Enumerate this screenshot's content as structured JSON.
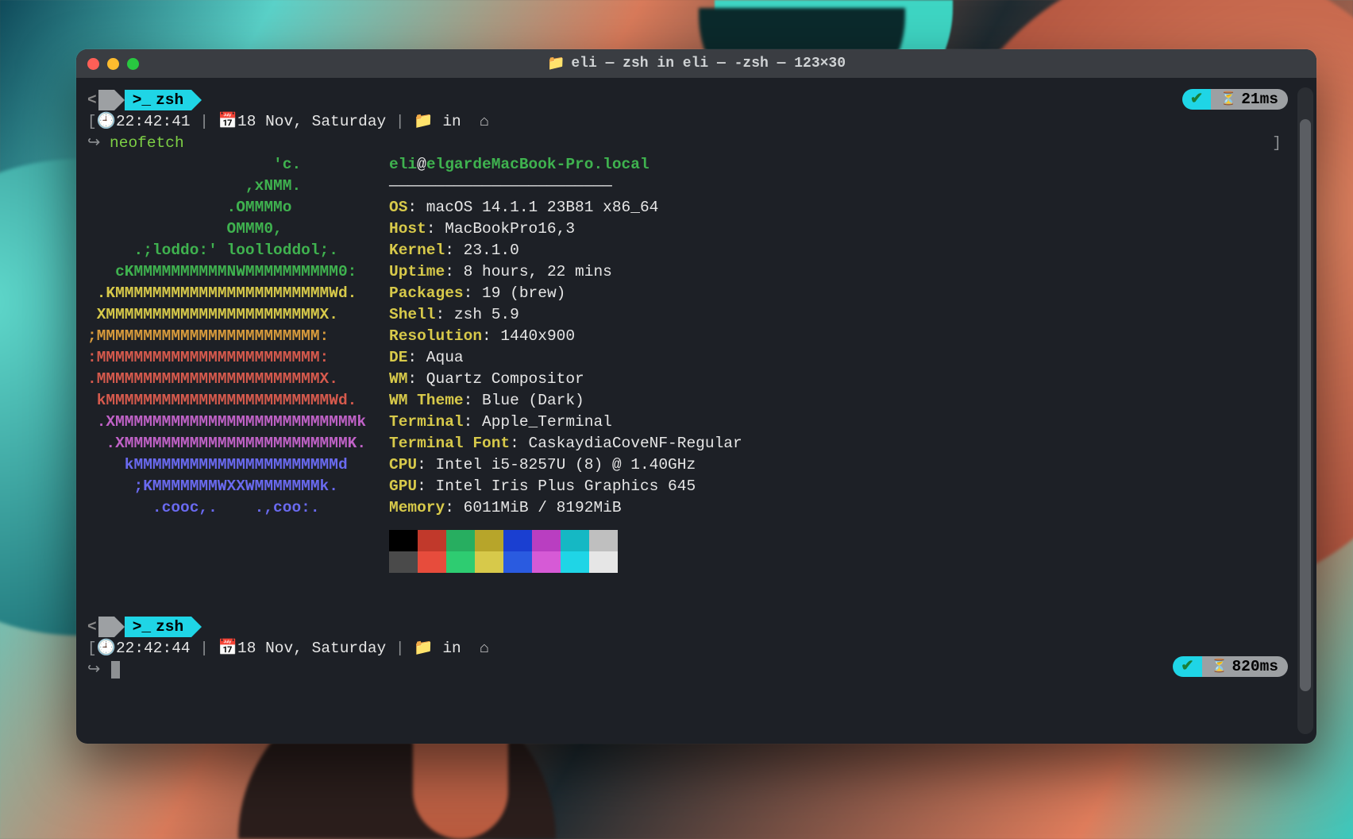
{
  "window": {
    "title": "eli — zsh in eli — -zsh — 123×30",
    "folder_icon": "📁"
  },
  "prompt1": {
    "apple": "",
    "shell_label": "zsh",
    "time": "22:42:41",
    "date": "18 Nov, Saturday",
    "in_word": "in",
    "badge_time": "21ms"
  },
  "command1": "neofetch",
  "logo": [
    "                    'c.          ",
    "                 ,xNMM.          ",
    "               .OMMMMo           ",
    "               OMMM0,            ",
    "     .;loddo:' loolloddol;.      ",
    "   cKMMMMMMMMMMNWMMMMMMMMMM0:    ",
    " .KMMMMMMMMMMMMMMMMMMMMMMMWd.    ",
    " XMMMMMMMMMMMMMMMMMMMMMMMX.      ",
    ";MMMMMMMMMMMMMMMMMMMMMMMM:       ",
    ":MMMMMMMMMMMMMMMMMMMMMMMM:       ",
    ".MMMMMMMMMMMMMMMMMMMMMMMMX.      ",
    " kMMMMMMMMMMMMMMMMMMMMMMMMWd.    ",
    " .XMMMMMMMMMMMMMMMMMMMMMMMMMMk   ",
    "  .XMMMMMMMMMMMMMMMMMMMMMMMMK.   ",
    "    kMMMMMMMMMMMMMMMMMMMMMMd     ",
    "     ;KMMMMMMMWXXWMMMMMMMk.      ",
    "       .cooc,.    .,coo:.        "
  ],
  "logo_colors": [
    "green",
    "green",
    "green",
    "green",
    "green",
    "green",
    "yellow",
    "yellow",
    "orange",
    "red",
    "red",
    "red",
    "violet",
    "violet",
    "blue",
    "blue",
    "blue"
  ],
  "header": {
    "user": "eli",
    "at": "@",
    "host": "elgardeMacBook-Pro.local",
    "rule": "————————————————————————"
  },
  "info": [
    {
      "k": "OS",
      "v": "macOS 14.1.1 23B81 x86_64"
    },
    {
      "k": "Host",
      "v": "MacBookPro16,3"
    },
    {
      "k": "Kernel",
      "v": "23.1.0"
    },
    {
      "k": "Uptime",
      "v": "8 hours, 22 mins"
    },
    {
      "k": "Packages",
      "v": "19 (brew)"
    },
    {
      "k": "Shell",
      "v": "zsh 5.9"
    },
    {
      "k": "Resolution",
      "v": "1440x900"
    },
    {
      "k": "DE",
      "v": "Aqua"
    },
    {
      "k": "WM",
      "v": "Quartz Compositor"
    },
    {
      "k": "WM Theme",
      "v": "Blue (Dark)"
    },
    {
      "k": "Terminal",
      "v": "Apple_Terminal"
    },
    {
      "k": "Terminal Font",
      "v": "CaskaydiaCoveNF-Regular"
    },
    {
      "k": "CPU",
      "v": "Intel i5-8257U (8) @ 1.40GHz"
    },
    {
      "k": "GPU",
      "v": "Intel Iris Plus Graphics 645"
    },
    {
      "k": "Memory",
      "v": "6011MiB / 8192MiB"
    }
  ],
  "prompt2": {
    "apple": "",
    "shell_label": "zsh",
    "time": "22:42:44",
    "date": "18 Nov, Saturday",
    "in_word": "in",
    "badge_time": "820ms"
  },
  "glyph": {
    "check": "✔",
    "hourglass": "⏳",
    "clock": "🕘",
    "cal": "📅",
    "folder": "📁",
    "home": "⌂",
    "term": ">_",
    "arrow": "↪",
    "left_br": "[",
    "right_br": "]"
  }
}
